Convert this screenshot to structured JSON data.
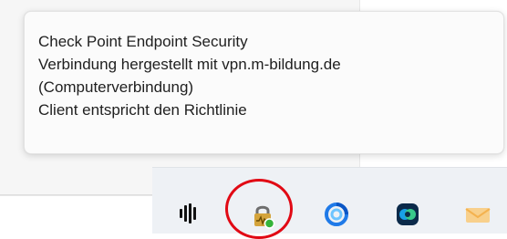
{
  "tooltip": {
    "lines": [
      "Check Point Endpoint Security",
      "Verbindung hergestellt mit vpn.m-bildung.de",
      "(Computerverbindung)",
      "Client entspricht den Richtlinie"
    ]
  },
  "tray": {
    "icons": [
      "audio-meter-icon",
      "checkpoint-vpn-lock-icon",
      "webex-ring-icon",
      "webex-meetings-icon",
      "mail-envelope-icon"
    ]
  },
  "colors": {
    "highlight_ring": "#e10914",
    "lock_green": "#35b43a",
    "lock_body": "#d4a43c"
  }
}
